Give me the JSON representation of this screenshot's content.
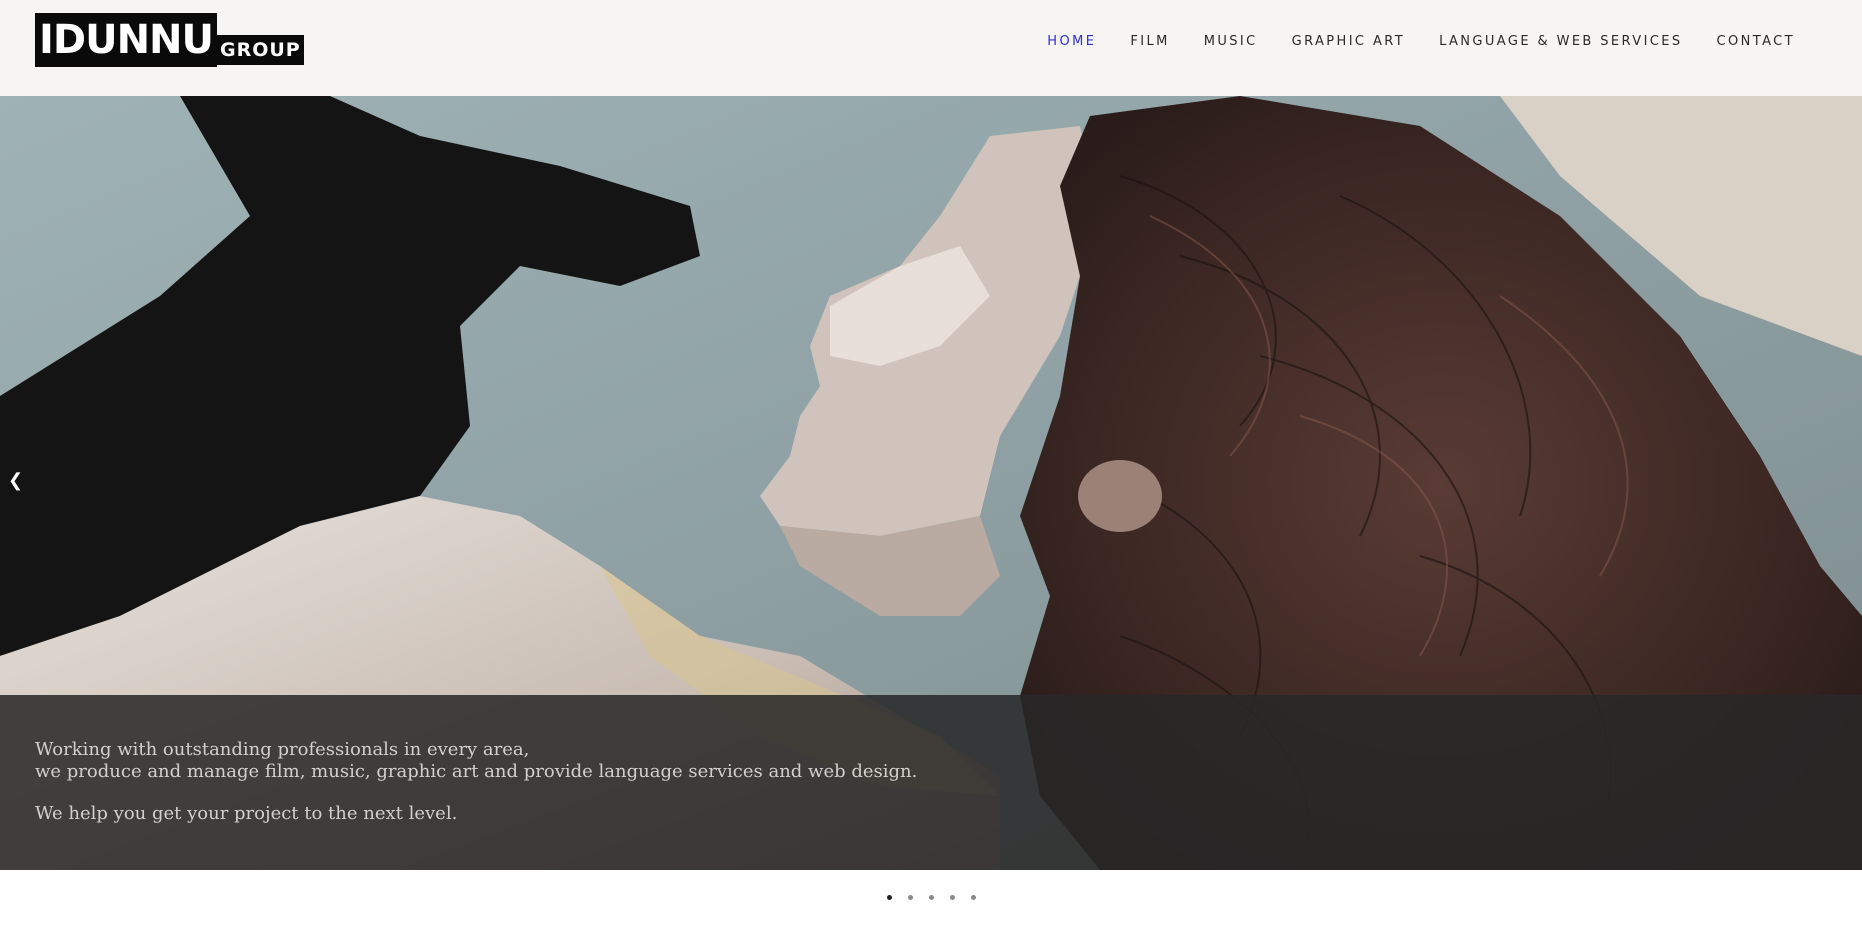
{
  "logo": {
    "main": "IDUNNU",
    "sub": "GROUP"
  },
  "nav": [
    {
      "label": "HOME",
      "active": true
    },
    {
      "label": "FILM",
      "active": false
    },
    {
      "label": "MUSIC",
      "active": false
    },
    {
      "label": "GRAPHIC ART",
      "active": false
    },
    {
      "label": "LANGUAGE & WEB SERVICES",
      "active": false
    },
    {
      "label": "CONTACT",
      "active": false
    }
  ],
  "slider": {
    "prev_icon": "chevron-left-icon",
    "caption": {
      "line1": "Working with outstanding professionals in every area,",
      "line2": "we produce and manage film, music,  graphic art and provide language services and web design.",
      "line3": "We help you get your project to the next level."
    },
    "dots": 5,
    "active_dot": 0
  },
  "colors": {
    "header_bg": "#f6f5f3",
    "nav_active": "#2f2fd0",
    "nav_text": "#2a2a2a",
    "caption_overlay": "#282828"
  }
}
